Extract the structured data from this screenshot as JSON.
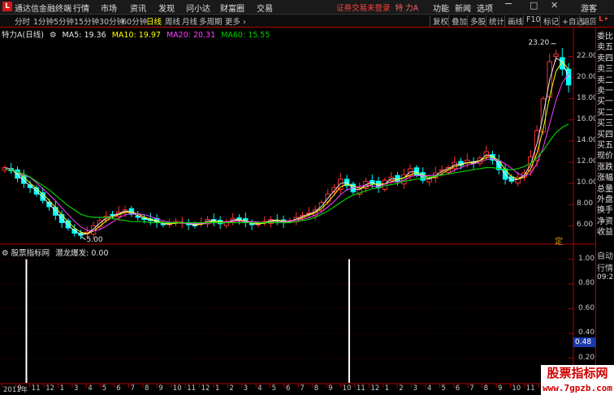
{
  "app": {
    "name": "通达信金融终端",
    "logo": "L",
    "menu": [
      "行情",
      "市场",
      "资讯",
      "发现",
      "问小达",
      "财富圈",
      "交易"
    ],
    "notice": "证券交易未登录",
    "stock_title": "特 力A",
    "top_right_menu": [
      "功能",
      "新闻",
      "选项"
    ],
    "guest_label": "游客"
  },
  "toolbar": {
    "periods": [
      "分时",
      "1分钟",
      "5分钟",
      "15分钟",
      "30分钟",
      "60分钟",
      "日线",
      "周线",
      "月线",
      "多周期",
      "更多"
    ],
    "active_period": "日线",
    "right_buttons": [
      "复权",
      "叠加",
      "多股",
      "统计",
      "画线",
      "F10",
      "标记",
      "+自选",
      "返回"
    ]
  },
  "chart_header": {
    "stock": "特力A",
    "period": "(日线)",
    "ma": [
      {
        "label": "MA5: 19.36",
        "color": "#e8e8e8"
      },
      {
        "label": "MA10: 19.97",
        "color": "#ffff00"
      },
      {
        "label": "MA20: 20.31",
        "color": "#ff40ff"
      },
      {
        "label": "MA60: 15.55",
        "color": "#00d000"
      }
    ]
  },
  "indicator": {
    "name": "股票指标网",
    "title": "潜龙爆发: 0.00",
    "current_marker": "0.48"
  },
  "chart_data": [
    {
      "type": "candlestick",
      "title": "",
      "ylim": [
        4.5,
        23.8
      ],
      "yticks": [
        "22.00",
        "20.00",
        "18.00",
        "16.00",
        "14.00",
        "12.00",
        "10.00",
        "8.00",
        "6.00"
      ],
      "yticks_values": [
        22,
        20,
        18,
        16,
        14,
        12,
        10,
        8,
        6
      ],
      "annotations": [
        {
          "label": "23.20",
          "value": 23.2
        },
        {
          "label": "5.00",
          "value": 5.0
        }
      ],
      "close_series_approx": [
        11.5,
        11.2,
        10.5,
        10.0,
        9.6,
        9.0,
        8.4,
        7.8,
        7.0,
        6.3,
        5.8,
        5.3,
        5.1,
        5.4,
        6.0,
        6.5,
        6.9,
        7.0,
        7.3,
        7.5,
        7.1,
        6.8,
        6.6,
        6.5,
        6.3,
        6.1,
        6.2,
        6.4,
        6.3,
        6.1,
        6.0,
        6.3,
        6.6,
        6.4,
        6.2,
        6.4,
        6.7,
        6.5,
        6.3,
        6.1,
        6.2,
        6.4,
        6.6,
        6.5,
        6.3,
        6.5,
        6.8,
        7.0,
        7.2,
        7.5,
        8.2,
        9.0,
        9.6,
        10.4,
        9.8,
        9.2,
        9.6,
        10.2,
        10.0,
        9.6,
        10.3,
        10.6,
        10.2,
        10.8,
        11.4,
        10.8,
        10.3,
        10.5,
        11.0,
        11.3,
        11.5,
        12.0,
        11.7,
        12.2,
        11.9,
        12.4,
        13.0,
        12.2,
        11.3,
        10.4,
        10.2,
        10.6,
        11.0,
        12.5,
        15.0,
        18.0,
        21.5,
        22.2,
        20.8,
        19.3
      ],
      "ma60_approx": [
        11.4,
        11.3,
        11.1,
        10.9,
        10.6,
        10.2,
        9.8,
        9.4,
        8.9,
        8.4,
        7.9,
        7.5,
        7.1,
        6.9,
        6.8,
        6.8,
        6.8,
        6.7,
        6.6,
        6.5,
        6.4,
        6.4,
        6.4,
        6.3,
        6.3,
        6.3,
        6.3,
        6.3,
        6.3,
        6.3,
        6.3,
        6.3,
        6.3,
        6.3,
        6.3,
        6.3,
        6.3,
        6.3,
        6.3,
        6.3,
        6.3,
        6.3,
        6.3,
        6.3,
        6.3,
        6.3,
        6.4,
        6.5,
        6.6,
        6.8,
        7.1,
        7.4,
        7.8,
        8.2,
        8.6,
        8.9,
        9.1,
        9.3,
        9.5,
        9.6,
        9.8,
        9.9,
        10.0,
        10.2,
        10.3,
        10.4,
        10.5,
        10.6,
        10.7,
        10.8,
        10.9,
        11.0,
        11.1,
        11.2,
        11.3,
        11.4,
        11.5,
        11.5,
        11.4,
        11.3,
        11.3,
        11.4,
        11.6,
        11.9,
        12.4,
        13.1,
        14.0,
        14.8,
        15.3,
        15.6
      ]
    },
    {
      "type": "bar",
      "title": "潜龙爆发",
      "ylim": [
        0,
        1.05
      ],
      "yticks": [
        "1.00",
        "0.80",
        "0.60",
        "0.40",
        "0.20"
      ],
      "yticks_values": [
        1.0,
        0.8,
        0.6,
        0.4,
        0.2
      ],
      "signals": [
        {
          "position": 0.046,
          "value": 1.0
        },
        {
          "position": 0.609,
          "value": 1.0
        }
      ]
    }
  ],
  "xaxis_labels": [
    "2011年",
    "9",
    "11",
    "12",
    "1",
    "3",
    "4",
    "5",
    "6",
    "7",
    "8",
    "9",
    "10",
    "11",
    "12",
    "1",
    "2",
    "3",
    "4",
    "5",
    "6",
    "7",
    "8",
    "9",
    "10",
    "11",
    "12",
    "1",
    "2",
    "3",
    "4",
    "5",
    "6",
    "7",
    "8",
    "9",
    "10",
    "11",
    "12",
    "1"
  ],
  "right_panel": {
    "items": [
      {
        "label": "委比",
        "color": "#e0e0e0"
      },
      {
        "label": "卖五",
        "color": "#e0e0e0"
      },
      {
        "label": "卖四",
        "color": "#e0e0e0"
      },
      {
        "label": "卖三",
        "color": "#e0e0e0"
      },
      {
        "label": "卖二",
        "color": "#e0e0e0"
      },
      {
        "label": "卖一",
        "color": "#e0e0e0"
      },
      {
        "label": "买一",
        "color": "#e0e0e0"
      },
      {
        "label": "买二",
        "color": "#e0e0e0"
      },
      {
        "label": "买三",
        "color": "#e0e0e0"
      },
      {
        "label": "买四",
        "color": "#e0e0e0"
      },
      {
        "label": "买五",
        "color": "#e0e0e0"
      },
      {
        "label": "现价",
        "color": "#e0e0e0"
      },
      {
        "label": "涨跌",
        "color": "#e0e0e0"
      },
      {
        "label": "涨幅",
        "color": "#e0e0e0"
      },
      {
        "label": "总量",
        "color": "#e0e0e0"
      },
      {
        "label": "外盘",
        "color": "#e0e0e0"
      },
      {
        "label": "换手",
        "color": "#e0e0e0"
      },
      {
        "label": "净资",
        "color": "#e0e0e0"
      },
      {
        "label": "收益",
        "color": "#e0e0e0"
      }
    ],
    "lower": [
      "自动",
      "行情",
      "09:25"
    ]
  },
  "pin_label": "定",
  "watermark": {
    "line1": "股票指标网",
    "line2": "www.7gpzb.com"
  },
  "colors": {
    "up": "#ff3030",
    "down": "#00ffff",
    "ma5": "#e8e8e8",
    "ma10": "#ffff00",
    "ma20": "#ff40ff",
    "ma60": "#00d000",
    "grid": "#8b0000",
    "accent": "#b00000"
  }
}
